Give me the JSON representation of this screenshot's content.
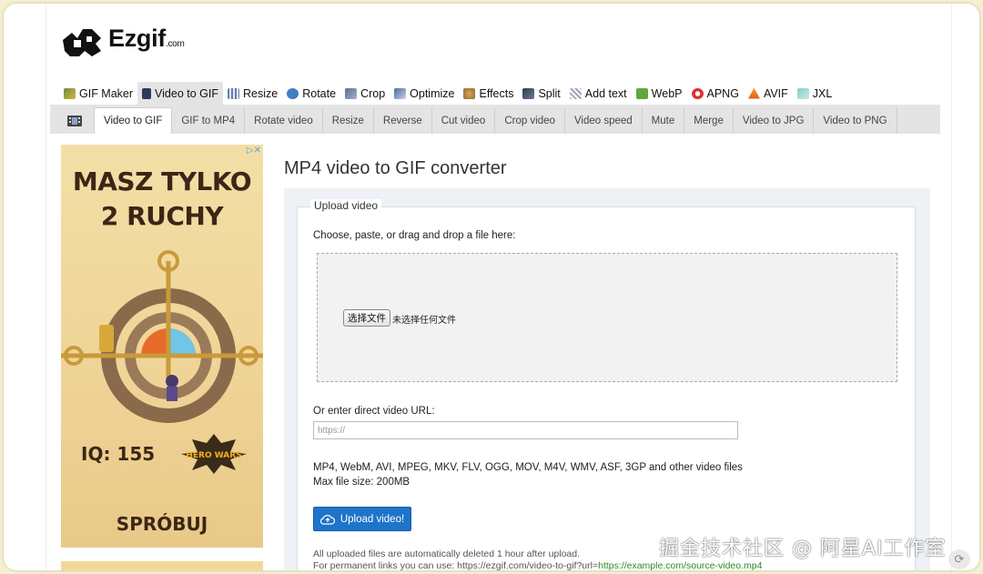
{
  "logo": {
    "text": "Ezgif",
    "suffix": ".com"
  },
  "main_nav": [
    {
      "label": "GIF Maker",
      "icon": "gif-maker-icon",
      "active": false
    },
    {
      "label": "Video to GIF",
      "icon": "video-icon",
      "active": true
    },
    {
      "label": "Resize",
      "icon": "resize-icon",
      "active": false
    },
    {
      "label": "Rotate",
      "icon": "rotate-icon",
      "active": false
    },
    {
      "label": "Crop",
      "icon": "crop-icon",
      "active": false
    },
    {
      "label": "Optimize",
      "icon": "optimize-icon",
      "active": false
    },
    {
      "label": "Effects",
      "icon": "effects-icon",
      "active": false
    },
    {
      "label": "Split",
      "icon": "split-icon",
      "active": false
    },
    {
      "label": "Add text",
      "icon": "add-text-icon",
      "active": false
    },
    {
      "label": "WebP",
      "icon": "webp-icon",
      "active": false
    },
    {
      "label": "APNG",
      "icon": "apng-icon",
      "active": false
    },
    {
      "label": "AVIF",
      "icon": "avif-icon",
      "active": false
    },
    {
      "label": "JXL",
      "icon": "jxl-icon",
      "active": false
    }
  ],
  "sub_nav": [
    {
      "label": "Video to GIF",
      "active": true
    },
    {
      "label": "GIF to MP4"
    },
    {
      "label": "Rotate video"
    },
    {
      "label": "Resize"
    },
    {
      "label": "Reverse"
    },
    {
      "label": "Cut video"
    },
    {
      "label": "Crop video"
    },
    {
      "label": "Video speed"
    },
    {
      "label": "Mute"
    },
    {
      "label": "Merge"
    },
    {
      "label": "Video to JPG"
    },
    {
      "label": "Video to PNG"
    }
  ],
  "ad": {
    "title_line1": "MASZ TYLKO",
    "title_line2": "2 RUCHY",
    "iq": "IQ: 155",
    "brand": "HERO WARS",
    "cta": "SPRÓBUJ"
  },
  "page_title": "MP4 video to GIF converter",
  "upload": {
    "legend": "Upload video",
    "choose_label": "Choose, paste, or drag and drop a file here:",
    "file_button": "选择文件",
    "file_none": "未选择任何文件",
    "url_label": "Or enter direct video URL:",
    "url_placeholder": "https://",
    "formats": "MP4, WebM, AVI, MPEG, MKV, FLV, OGG, MOV, M4V, WMV, ASF, 3GP and other video files",
    "max_size": "Max file size: 200MB",
    "button": "Upload video!",
    "note1": "All uploaded files are automatically deleted 1 hour after upload.",
    "note2_prefix": "For permanent links you can use: https://ezgif.com/video-to-gif?url=",
    "note2_link": "https://example.com/source-video.mp4"
  },
  "watermark": "掘金技术社区 @ 阿星AI工作室",
  "colors": {
    "accent": "#1d74c9",
    "nav_bg": "#e4e4e4",
    "panel_bg": "#eef2f6",
    "link_green": "#2a8a2a"
  }
}
